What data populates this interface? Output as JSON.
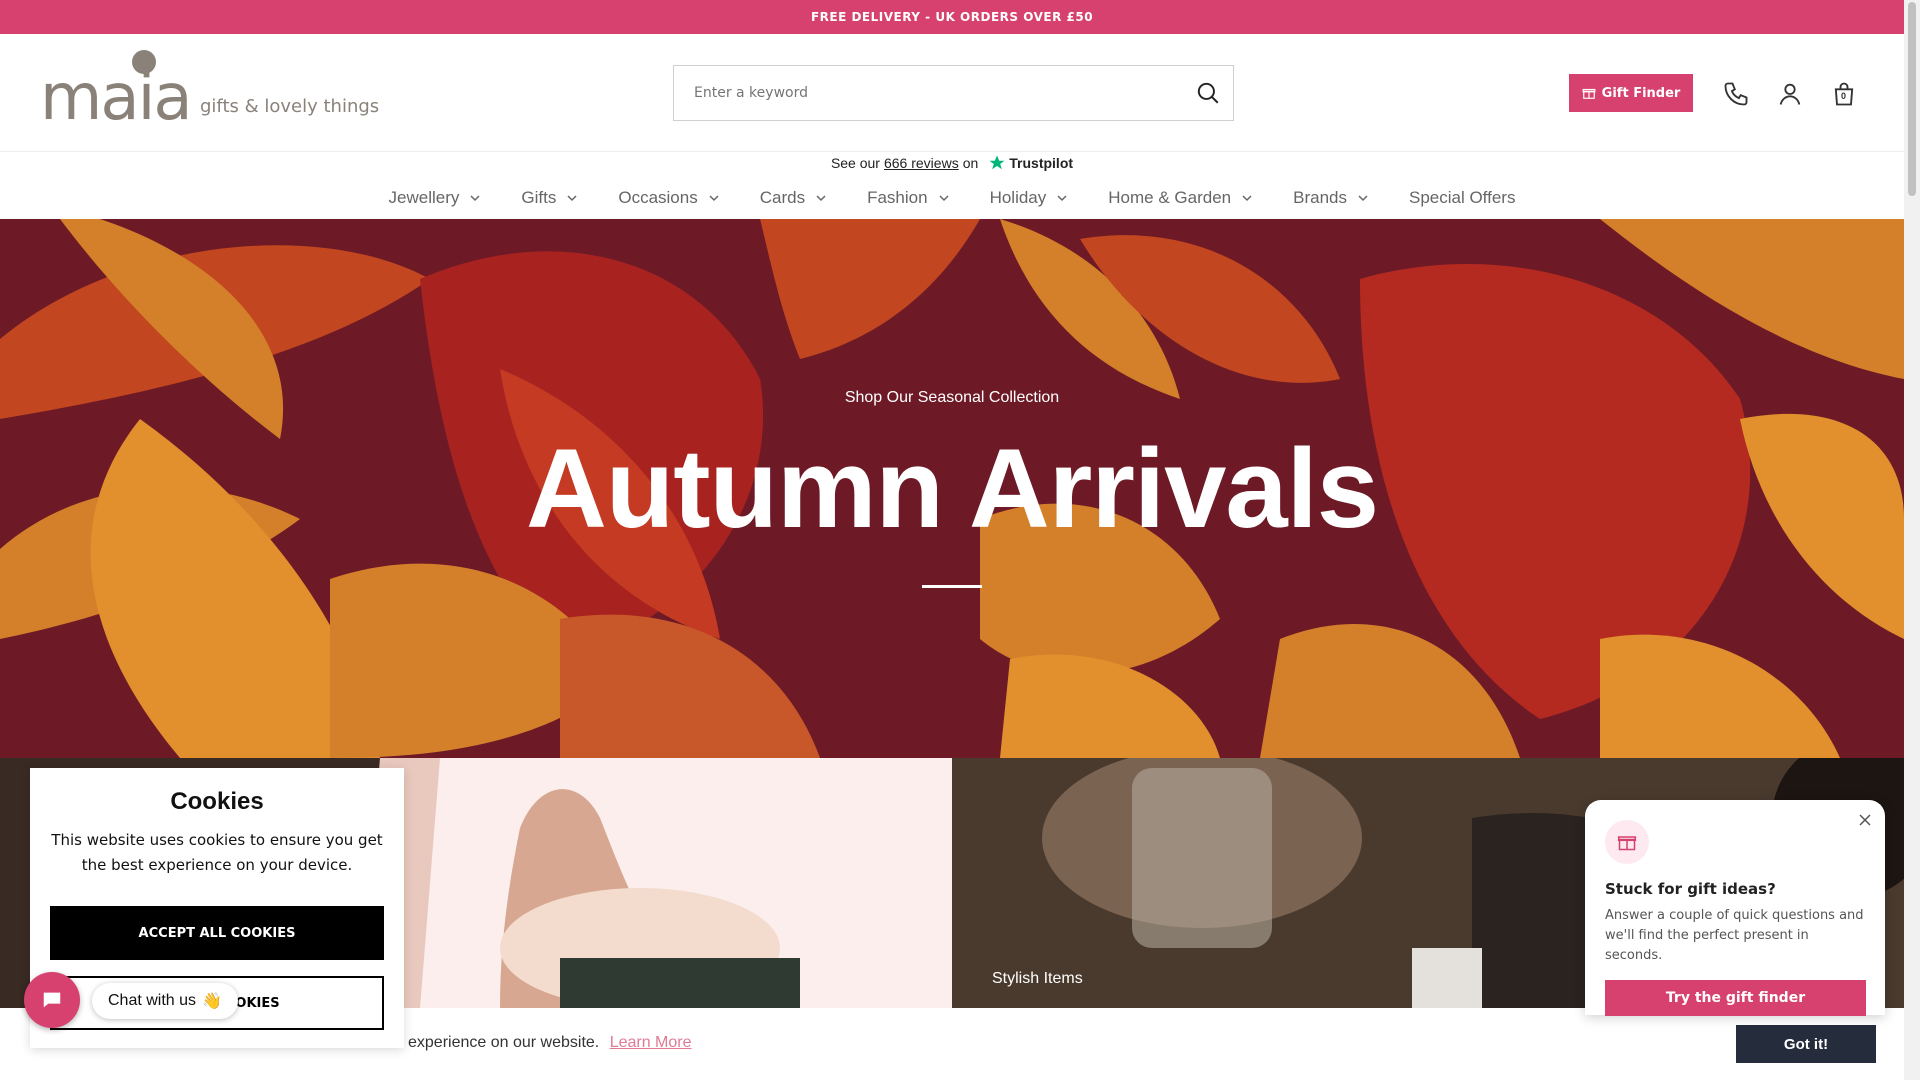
{
  "announcement": "FREE DELIVERY - UK ORDERS OVER £50",
  "logo": {
    "wordmark": "maia",
    "tagline": "gifts & lovely things"
  },
  "search": {
    "placeholder": "Enter a keyword"
  },
  "header": {
    "gift_finder_label": "Gift Finder",
    "cart_count": "0"
  },
  "trustpilot": {
    "prefix": "See our",
    "count": "666 reviews",
    "suffix": "on",
    "brand": "Trustpilot"
  },
  "nav": [
    {
      "label": "Jewellery",
      "dropdown": true
    },
    {
      "label": "Gifts",
      "dropdown": true
    },
    {
      "label": "Occasions",
      "dropdown": true
    },
    {
      "label": "Cards",
      "dropdown": true
    },
    {
      "label": "Fashion",
      "dropdown": true
    },
    {
      "label": "Holiday",
      "dropdown": true
    },
    {
      "label": "Home & Garden",
      "dropdown": true
    },
    {
      "label": "Brands",
      "dropdown": true
    },
    {
      "label": "Special Offers",
      "dropdown": false
    }
  ],
  "hero": {
    "subtitle": "Shop Our Seasonal Collection",
    "title": "Autumn Arrivals"
  },
  "tiles": {
    "right_caption": "Stylish Items"
  },
  "cookie_panel": {
    "title": "Cookies",
    "body": "This website uses cookies to ensure you get the best experience on your device.",
    "accept_label": "ACCEPT ALL COOKIES",
    "manage_label": "OOKIES"
  },
  "chat": {
    "label": "Chat with us",
    "emoji": "👋"
  },
  "cookie_bar": {
    "message": "experience on our website.",
    "learn_more": "Learn More",
    "button": "Got it!"
  },
  "gift_popup": {
    "title": "Stuck for gift ideas?",
    "body": "Answer a couple of quick questions and we'll find the perfect present in seconds.",
    "button": "Try the gift finder"
  },
  "colors": {
    "brand_pink": "#d6416f",
    "logo_grey": "#8a8279",
    "dark_button": "#252d3c",
    "hero_maroon": "#6e1a26"
  }
}
